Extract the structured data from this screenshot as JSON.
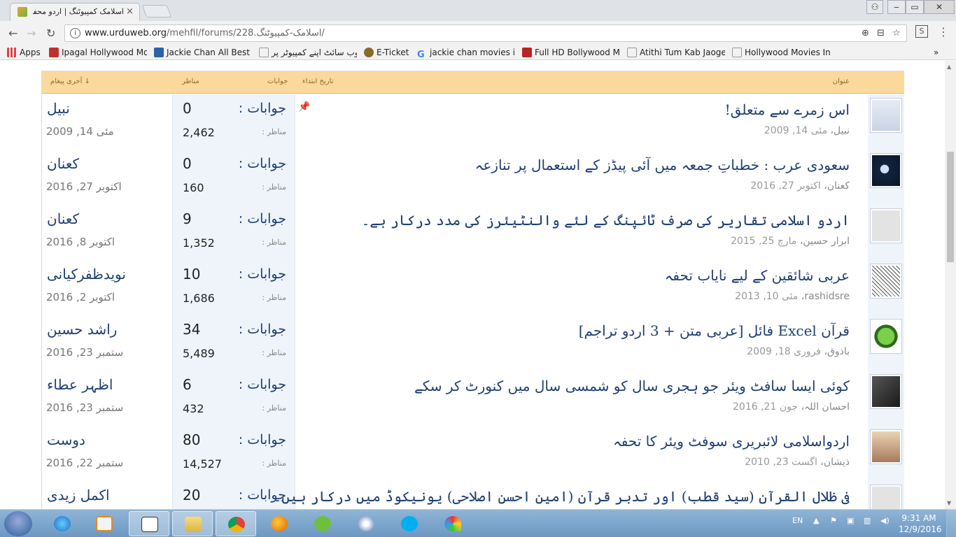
{
  "browser": {
    "tab_title": "اسلامک کمپیوٹنگ | اردو محفل فو",
    "window_buttons": [
      "‒",
      "▭",
      "✕"
    ],
    "url_host": "www.urduweb.org",
    "url_path": "/mehfil/forums/228.اسلامک-کمپیوٹنگ/",
    "bookmarks": [
      {
        "label": "Apps",
        "icon": "apps-grid-icon",
        "color": "#d44"
      },
      {
        "label": "Ipagal Hollywood Mo",
        "icon": "ipagal-icon",
        "color": "#c0302a"
      },
      {
        "label": "Jackie Chan All Best M",
        "icon": "facebook-icon",
        "color": "#2c62a8"
      },
      {
        "label": "وب سائٹ اپنے کمپیوٹر پر",
        "icon": "page-icon",
        "color": "#999"
      },
      {
        "label": "E-Ticket",
        "icon": "eticket-icon",
        "color": "#8a6a2a"
      },
      {
        "label": "jackie chan movies in",
        "icon": "google-icon",
        "color": "#4285f4"
      },
      {
        "label": "Full HD Bollywood Mo",
        "icon": "hd-icon",
        "color": "#b22"
      },
      {
        "label": "Atithi Tum Kab Jaoge",
        "icon": "page-icon",
        "color": "#999"
      },
      {
        "label": "Hollywood Movies In",
        "icon": "page-icon",
        "color": "#999"
      }
    ],
    "more_bookmarks": "»"
  },
  "forum": {
    "columns": {
      "title": "عنوان",
      "started": "تاریخ ابتداء",
      "replies": "جوابات",
      "views": "مناظر",
      "last_post": "آخری پیغام ↓"
    },
    "replies_label": "جوابات :",
    "views_label": "مناظر :",
    "threads": [
      {
        "title": "اس زمرے سے متعلق!",
        "author": "نبیل",
        "date": "مئی 14, 2009",
        "replies": "0",
        "views": "2,462",
        "last_user": "نبیل",
        "last_date": "مئی 14, 2009",
        "sticky": true,
        "avatar": "default-avatar"
      },
      {
        "title": "سعودی عرب : خطباتِ جمعہ میں آئی پیڈز کے استعمال پر تنازعہ",
        "author": "کعنان",
        "date": "اکتوبر 27, 2016",
        "replies": "0",
        "views": "160",
        "last_user": "کعنان",
        "last_date": "اکتوبر 27, 2016",
        "sticky": false,
        "avatar": "moon-avatar"
      },
      {
        "title": "اردو اسلامی تقاریر کی صرف ٹائپنگ کے لئے والنٹیئرز کی مدد درکار ہے۔",
        "author": "ابرار حسین",
        "date": "مارچ 25, 2015",
        "replies": "9",
        "views": "1,352",
        "last_user": "کعنان",
        "last_date": "اکتوبر 8, 2016",
        "sticky": false,
        "avatar": "male-symbol-avatar"
      },
      {
        "title": "عربی شائقین کے لیے نایاب تحفہ",
        "author": "rashidsre",
        "date": "مئی 10, 2013",
        "replies": "10",
        "views": "1,686",
        "last_user": "نویدظفرکیانی",
        "last_date": "اکتوبر 2, 2016",
        "sticky": false,
        "avatar": "calligraphy-avatar"
      },
      {
        "title": "قرآن Excel فائل [عربی متن + 3 اردو تراجم]",
        "author": "باذوق",
        "date": "فروری 18, 2009",
        "replies": "34",
        "views": "5,489",
        "last_user": "راشد حسین",
        "last_date": "ستمبر 23, 2016",
        "sticky": false,
        "avatar": "green-button-avatar"
      },
      {
        "title": "کوئی ایسا سافٹ ویئر جو ہجری سال کو شمسی سال میں کنورٹ کر سکے",
        "author": "احسان اللہ",
        "date": "جون 21, 2016",
        "replies": "6",
        "views": "432",
        "last_user": "اظہر عطاء",
        "last_date": "ستمبر 23, 2016",
        "sticky": false,
        "avatar": "photo-avatar"
      },
      {
        "title": "اردواسلامی لائبریری سوفٹ ویئر کا تحفہ",
        "author": "ذیشان",
        "date": "اگست 23, 2010",
        "replies": "80",
        "views": "14,527",
        "last_user": "دوست",
        "last_date": "ستمبر 22, 2016",
        "sticky": false,
        "avatar": "building-avatar"
      },
      {
        "title": "فی ظلال القرآن (سید قطب) اور تدبر قرآن (امین احسن اصلاحی) یونیکوڈ میں درکار ہیں۔",
        "author": "",
        "date": "",
        "replies": "20",
        "views": "",
        "last_user": "اکمل زیدی",
        "last_date": "",
        "sticky": false,
        "avatar": "male-symbol-avatar"
      }
    ]
  },
  "taskbar": {
    "apps": [
      "internet-explorer",
      "media-player",
      "ocr-app",
      "file-explorer",
      "chrome",
      "firefox",
      "evernote",
      "torrent",
      "skype",
      "paint"
    ],
    "language": "EN",
    "time": "9:31 AM",
    "date": "12/9/2016"
  }
}
